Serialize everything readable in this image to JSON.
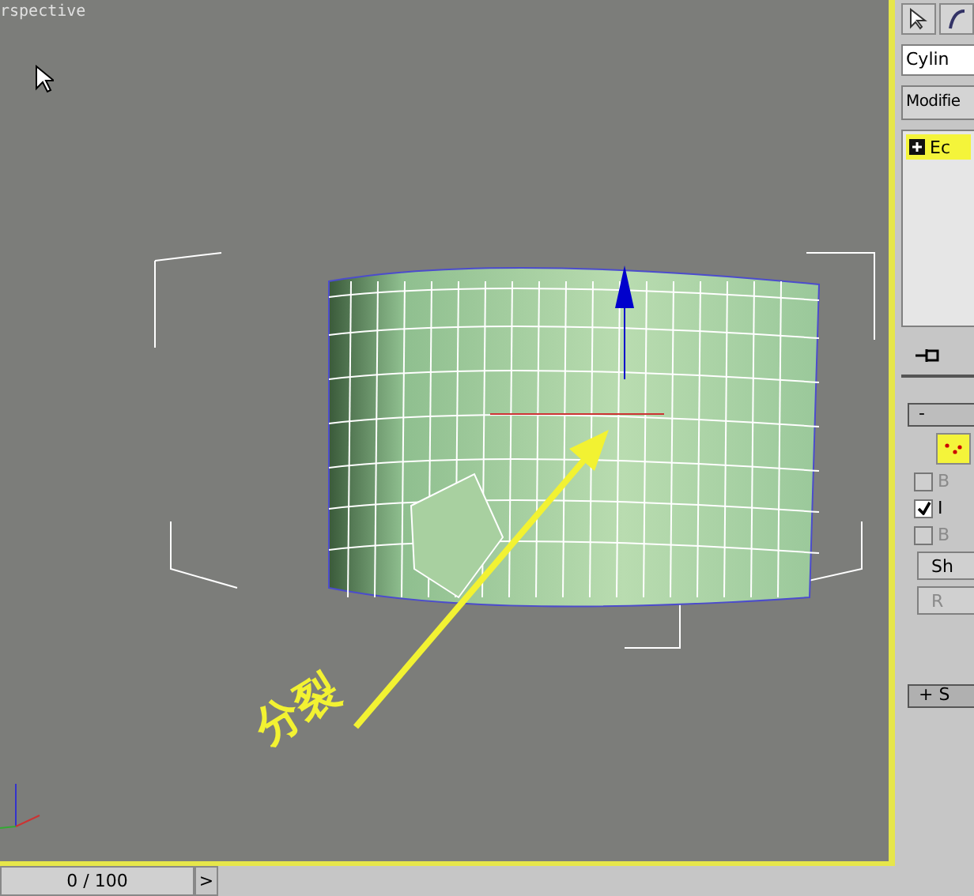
{
  "viewport": {
    "label": "rspective",
    "annotation": "分裂"
  },
  "command_panel": {
    "object_name": "Cylin",
    "modifier_list": "Modifie",
    "stack": [
      {
        "label": "Ec",
        "selected": true
      }
    ],
    "rollout": {
      "toggle": "-",
      "expanded": true,
      "options": [
        {
          "kind": "checkbox",
          "label": "B",
          "checked": false,
          "disabled": true
        },
        {
          "kind": "checkbox",
          "label": "I",
          "checked": true,
          "disabled": false
        },
        {
          "kind": "checkbox",
          "label": "B",
          "checked": false,
          "disabled": true
        },
        {
          "kind": "button",
          "label": "Sh",
          "disabled": false
        },
        {
          "kind": "button",
          "label": "R",
          "disabled": true
        }
      ]
    },
    "collapsed_rollout": {
      "toggle": "+",
      "label": "S",
      "expanded": false
    }
  },
  "time_slider": {
    "frame": "0 / 100",
    "next": ">"
  }
}
